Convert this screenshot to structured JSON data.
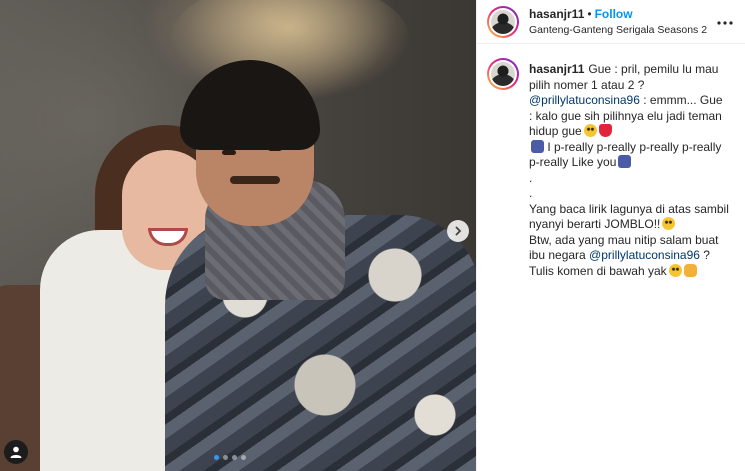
{
  "post": {
    "username": "hasanjr11",
    "separator": "•",
    "follow_label": "Follow",
    "location": "Ganteng-Ganteng Serigala Seasons 2",
    "more_icon": "more-options-icon",
    "carousel": {
      "slide_count": 4,
      "active_index": 0,
      "next_icon": "chevron-right-icon",
      "tag_icon": "user-tag-icon"
    }
  },
  "caption": {
    "username": "hasanjr11",
    "l1": "Gue : pril, pemilu lu mau pilih nomer 1 atau 2 ?",
    "l2_mention": "@prillylatuconsina96",
    "l2_text": " : emmm... Gue : kalo gue sih pilihnya elu jadi teman hidup gue",
    "l3_text": " I p-really p-really p-really p-really p-really Like you",
    "dot1": ".",
    "dot2": ".",
    "l4_text": "Yang baca lirik lagunya di atas sambil nyanyi berarti JOMBLO!!",
    "l5_text": "Btw, ada yang mau nitip salam buat ibu negara ",
    "l5_mention": "@prillylatuconsina96",
    "l5_end": " ?",
    "l6_text": "Tulis komen di bawah yak",
    "emojis": [
      "grinning-face-emoji",
      "heart-emoji",
      "bus-emoji",
      "camera-emoji",
      "laughing-face-emoji",
      "smiling-face-emoji",
      "pointing-hand-emoji"
    ]
  },
  "colors": {
    "follow": "#0095f6",
    "mention": "#00376b",
    "text": "#262626",
    "border": "#efefef"
  }
}
